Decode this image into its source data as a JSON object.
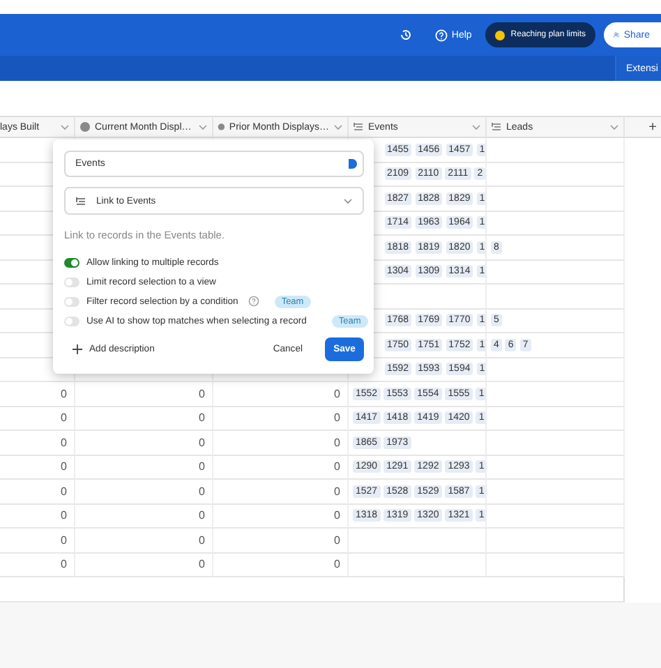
{
  "topbar": {
    "help": "Help",
    "plan_badge": "Reaching plan limits",
    "share": "Share"
  },
  "subbar": {
    "tab": "Extensi"
  },
  "columns": [
    {
      "label": "lays Built",
      "kind": "plain"
    },
    {
      "label": "Current Month Displ…",
      "kind": "formula"
    },
    {
      "label": "Prior Month Displays…",
      "kind": "formula"
    },
    {
      "label": "Events",
      "kind": "link"
    },
    {
      "label": "Leads",
      "kind": "link"
    }
  ],
  "add_column": "+",
  "rows": [
    {
      "events": [
        "1455",
        "1456",
        "1457",
        "1"
      ],
      "leads": []
    },
    {
      "events": [
        "2109",
        "2110",
        "2111",
        "2"
      ],
      "leads": []
    },
    {
      "events": [
        "1827",
        "1828",
        "1829",
        "1"
      ],
      "leads": []
    },
    {
      "events": [
        "1714",
        "1963",
        "1964",
        "1"
      ],
      "leads": []
    },
    {
      "events": [
        "1818",
        "1819",
        "1820",
        "1"
      ],
      "leads": [
        "8"
      ]
    },
    {
      "events": [
        "1304",
        "1309",
        "1314",
        "1"
      ],
      "leads": []
    },
    {
      "events": [],
      "leads": []
    },
    {
      "events": [
        "1768",
        "1769",
        "1770",
        "1"
      ],
      "leads": [
        "5"
      ]
    },
    {
      "events": [
        "1750",
        "1751",
        "1752",
        "1"
      ],
      "leads": [
        "4",
        "6",
        "7"
      ]
    },
    {
      "events": [
        "1592",
        "1593",
        "1594",
        "1"
      ],
      "leads": []
    },
    {
      "values": [
        "0",
        "0",
        "0"
      ],
      "events": [
        "1552",
        "1553",
        "1554",
        "1555",
        "1"
      ],
      "leads": []
    },
    {
      "values": [
        "0",
        "0",
        "0"
      ],
      "events": [
        "1417",
        "1418",
        "1419",
        "1420",
        "1"
      ],
      "leads": []
    },
    {
      "values": [
        "0",
        "0",
        "0"
      ],
      "events": [
        "1865",
        "1973"
      ],
      "leads": []
    },
    {
      "values": [
        "0",
        "0",
        "0"
      ],
      "events": [
        "1290",
        "1291",
        "1292",
        "1293",
        "1"
      ],
      "leads": []
    },
    {
      "values": [
        "0",
        "0",
        "0"
      ],
      "events": [
        "1527",
        "1528",
        "1529",
        "1587",
        "1"
      ],
      "leads": []
    },
    {
      "values": [
        "0",
        "0",
        "0"
      ],
      "events": [
        "1318",
        "1319",
        "1320",
        "1321",
        "1"
      ],
      "leads": []
    },
    {
      "values": [
        "0",
        "0",
        "0"
      ],
      "events": [],
      "leads": []
    },
    {
      "values": [
        "0",
        "0",
        "0"
      ],
      "events": [],
      "leads": []
    }
  ],
  "popup": {
    "name_value": "Events",
    "field_type": "Link to Events",
    "description": "Link to records in the Events table.",
    "options": [
      {
        "kind": "plain",
        "label": "Allow linking to multiple records",
        "on": true
      },
      {
        "kind": "plain",
        "label": "Limit record selection to a view",
        "on": false
      },
      {
        "kind": "info",
        "label": "Filter record selection by a condition",
        "on": false,
        "badge": "Team"
      },
      {
        "kind": "sparkle",
        "label": "Use AI to show top matches when selecting a record",
        "on": false,
        "badge": "Team"
      }
    ],
    "add_description": "Add description",
    "cancel": "Cancel",
    "save": "Save"
  }
}
